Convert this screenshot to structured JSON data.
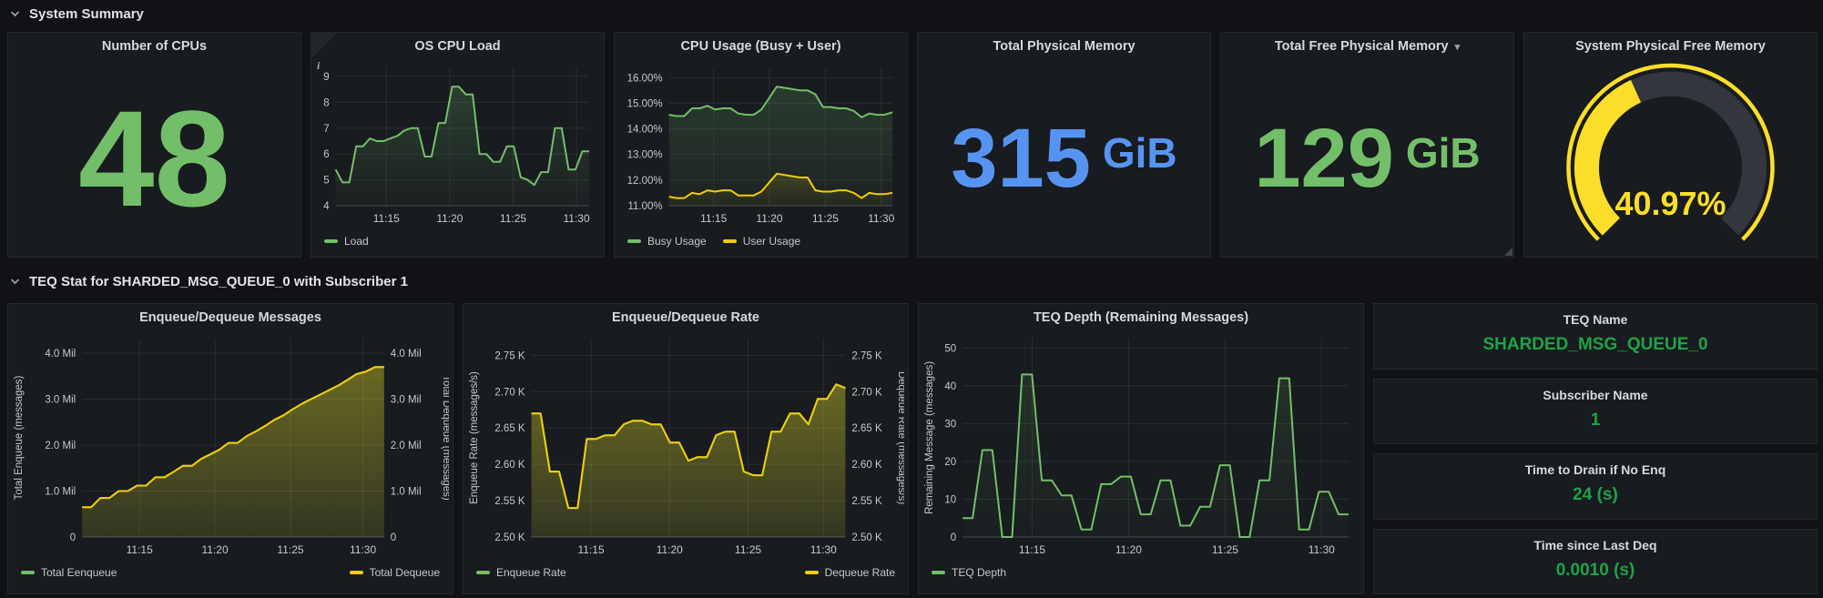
{
  "colors": {
    "green": "#73BF69",
    "yellow": "#F2CC0C",
    "blue": "#5794F2",
    "stat_green": "#1DA446",
    "gauge_yellow": "#FADE2A"
  },
  "sections": {
    "system": {
      "title": "System Summary"
    },
    "teq": {
      "title": "TEQ Stat for SHARDED_MSG_QUEUE_0 with Subscriber 1"
    }
  },
  "panels": {
    "num_cpus": {
      "title": "Number of CPUs",
      "value": "48"
    },
    "total_mem": {
      "title": "Total Physical Memory",
      "value": "315",
      "unit": "GiB"
    },
    "free_mem": {
      "title": "Total Free Physical Memory",
      "value": "129",
      "unit": "GiB"
    },
    "gauge": {
      "title": "System Physical Free Memory",
      "value": "40.97%",
      "percent": 40.97
    },
    "teq_name": {
      "title": "TEQ Name",
      "value": "SHARDED_MSG_QUEUE_0"
    },
    "subscriber": {
      "title": "Subscriber Name",
      "value": "1"
    },
    "drain": {
      "title": "Time to Drain if No Enq",
      "value": "24 (s)"
    },
    "last_deq": {
      "title": "Time since Last Deq",
      "value": "0.0010 (s)"
    }
  },
  "chart_data": [
    {
      "id": "os_cpu_load",
      "type": "line",
      "title": "OS CPU Load",
      "ylim": [
        4,
        9.35
      ],
      "yticks": [
        {
          "v": 4,
          "label": "4"
        },
        {
          "v": 5,
          "label": "5"
        },
        {
          "v": 6,
          "label": "6"
        },
        {
          "v": 7,
          "label": "7"
        },
        {
          "v": 8,
          "label": "8"
        },
        {
          "v": 9,
          "label": "9"
        }
      ],
      "xticks": [
        {
          "frac": 0.2,
          "label": "11:15"
        },
        {
          "frac": 0.45,
          "label": "11:20"
        },
        {
          "frac": 0.7,
          "label": "11:25"
        },
        {
          "frac": 0.95,
          "label": "11:30"
        }
      ],
      "right_ticks": false,
      "legend_split": false,
      "series": [
        {
          "name": "Load",
          "color": "#73BF69",
          "fill_top": 0.22,
          "fill_bottom": 0.03,
          "values": [
            5.4,
            4.9,
            4.9,
            6.3,
            6.3,
            6.6,
            6.5,
            6.5,
            6.6,
            6.7,
            6.9,
            7.0,
            7.0,
            5.9,
            5.9,
            7.2,
            7.2,
            8.6,
            8.6,
            8.3,
            8.3,
            6.0,
            6.0,
            5.7,
            5.7,
            6.3,
            6.3,
            5.1,
            5.0,
            4.8,
            5.3,
            5.3,
            7.0,
            7.0,
            5.4,
            5.4,
            6.1,
            6.1
          ]
        }
      ]
    },
    {
      "id": "cpu_usage",
      "type": "line",
      "title": "CPU Usage (Busy + User)",
      "ylim": [
        11,
        16.4
      ],
      "yticks": [
        {
          "v": 11,
          "label": "11.00%"
        },
        {
          "v": 12,
          "label": "12.00%"
        },
        {
          "v": 13,
          "label": "13.00%"
        },
        {
          "v": 14,
          "label": "14.00%"
        },
        {
          "v": 15,
          "label": "15.00%"
        },
        {
          "v": 16,
          "label": "16.00%"
        }
      ],
      "xticks": [
        {
          "frac": 0.2,
          "label": "11:15"
        },
        {
          "frac": 0.45,
          "label": "11:20"
        },
        {
          "frac": 0.7,
          "label": "11:25"
        },
        {
          "frac": 0.95,
          "label": "11:30"
        }
      ],
      "right_ticks": false,
      "legend_split": false,
      "series": [
        {
          "name": "Busy Usage",
          "color": "#73BF69",
          "fill_top": 0.2,
          "fill_bottom": 0.04,
          "values": [
            14.55,
            14.5,
            14.5,
            14.8,
            14.8,
            14.9,
            14.75,
            14.8,
            14.8,
            14.6,
            14.55,
            14.55,
            14.75,
            15.2,
            15.65,
            15.6,
            15.55,
            15.5,
            15.5,
            15.35,
            14.85,
            14.85,
            14.8,
            14.8,
            14.7,
            14.45,
            14.6,
            14.55,
            14.55,
            14.65
          ]
        },
        {
          "name": "User Usage",
          "color": "#F2CC0C",
          "fill_top": 0.16,
          "fill_bottom": 0.03,
          "values": [
            11.35,
            11.3,
            11.3,
            11.5,
            11.45,
            11.6,
            11.55,
            11.6,
            11.6,
            11.4,
            11.4,
            11.4,
            11.55,
            11.9,
            12.25,
            12.2,
            12.15,
            12.1,
            12.1,
            11.6,
            11.55,
            11.55,
            11.6,
            11.6,
            11.5,
            11.3,
            11.5,
            11.45,
            11.45,
            11.5
          ]
        }
      ]
    },
    {
      "id": "enq_deq_messages",
      "type": "area",
      "title": "Enqueue/Dequeue Messages",
      "ylim": [
        0,
        4.32
      ],
      "yticks": [
        {
          "v": 0,
          "label": "0"
        },
        {
          "v": 1,
          "label": "1.0 Mil"
        },
        {
          "v": 2,
          "label": "2.0 Mil"
        },
        {
          "v": 3,
          "label": "3.0 Mil"
        },
        {
          "v": 4,
          "label": "4.0 Mil"
        }
      ],
      "xticks": [
        {
          "frac": 0.19,
          "label": "11:15"
        },
        {
          "frac": 0.44,
          "label": "11:20"
        },
        {
          "frac": 0.69,
          "label": "11:25"
        },
        {
          "frac": 0.93,
          "label": "11:30"
        }
      ],
      "right_ticks": true,
      "legend_split": true,
      "axis_left": "Total Enqueue (messages)",
      "axis_right": "Total Dequeue (messages)",
      "series": [
        {
          "name": "Total Eenqueue",
          "color": "#73BF69",
          "fill_top": 0.18,
          "fill_bottom": 0.06,
          "values": [
            0.65,
            0.65,
            0.85,
            0.85,
            1.0,
            1.0,
            1.12,
            1.12,
            1.3,
            1.3,
            1.42,
            1.55,
            1.55,
            1.7,
            1.8,
            1.9,
            2.05,
            2.05,
            2.2,
            2.3,
            2.42,
            2.55,
            2.65,
            2.78,
            2.9,
            3.0,
            3.1,
            3.2,
            3.3,
            3.42,
            3.55,
            3.6,
            3.7,
            3.7
          ]
        },
        {
          "name": "Total Dequeue",
          "color": "#F2CC0C",
          "fill_top": 0.32,
          "fill_bottom": 0.1,
          "values": [
            0.65,
            0.65,
            0.85,
            0.85,
            1.0,
            1.0,
            1.12,
            1.12,
            1.3,
            1.3,
            1.42,
            1.55,
            1.55,
            1.7,
            1.8,
            1.9,
            2.05,
            2.05,
            2.2,
            2.3,
            2.42,
            2.55,
            2.65,
            2.78,
            2.9,
            3.0,
            3.1,
            3.2,
            3.3,
            3.42,
            3.55,
            3.6,
            3.7,
            3.7
          ]
        }
      ]
    },
    {
      "id": "enq_deq_rate",
      "type": "area",
      "title": "Enqueue/Dequeue Rate",
      "ylim": [
        2.5,
        2.773
      ],
      "yticks": [
        {
          "v": 2.5,
          "label": "2.50 K"
        },
        {
          "v": 2.55,
          "label": "2.55 K"
        },
        {
          "v": 2.6,
          "label": "2.60 K"
        },
        {
          "v": 2.65,
          "label": "2.65 K"
        },
        {
          "v": 2.7,
          "label": "2.70 K"
        },
        {
          "v": 2.75,
          "label": "2.75 K"
        }
      ],
      "xticks": [
        {
          "frac": 0.19,
          "label": "11:15"
        },
        {
          "frac": 0.44,
          "label": "11:20"
        },
        {
          "frac": 0.69,
          "label": "11:25"
        },
        {
          "frac": 0.93,
          "label": "11:30"
        }
      ],
      "right_ticks": true,
      "legend_split": true,
      "axis_left": "Enqueue Rate (messages/s)",
      "axis_right": "Dequeue Rate (messages/s)",
      "series": [
        {
          "name": "Enqueue Rate",
          "color": "#73BF69",
          "fill_top": 0.18,
          "fill_bottom": 0.06,
          "values": [
            2.67,
            2.67,
            2.59,
            2.59,
            2.54,
            2.54,
            2.635,
            2.635,
            2.64,
            2.64,
            2.655,
            2.66,
            2.66,
            2.655,
            2.655,
            2.63,
            2.63,
            2.605,
            2.61,
            2.61,
            2.64,
            2.645,
            2.645,
            2.59,
            2.585,
            2.585,
            2.645,
            2.645,
            2.67,
            2.67,
            2.655,
            2.69,
            2.69,
            2.71,
            2.705
          ]
        },
        {
          "name": "Dequeue Rate",
          "color": "#F2CC0C",
          "fill_top": 0.32,
          "fill_bottom": 0.1,
          "values": [
            2.67,
            2.67,
            2.59,
            2.59,
            2.54,
            2.54,
            2.635,
            2.635,
            2.64,
            2.64,
            2.655,
            2.66,
            2.66,
            2.655,
            2.655,
            2.63,
            2.63,
            2.605,
            2.61,
            2.61,
            2.64,
            2.645,
            2.645,
            2.59,
            2.585,
            2.585,
            2.645,
            2.645,
            2.67,
            2.67,
            2.655,
            2.69,
            2.69,
            2.71,
            2.705
          ]
        }
      ]
    },
    {
      "id": "teq_depth",
      "type": "line",
      "title": "TEQ Depth (Remaining Messages)",
      "ylim": [
        0,
        52.5
      ],
      "yticks": [
        {
          "v": 0,
          "label": "0"
        },
        {
          "v": 10,
          "label": "10"
        },
        {
          "v": 20,
          "label": "20"
        },
        {
          "v": 30,
          "label": "30"
        },
        {
          "v": 40,
          "label": "40"
        },
        {
          "v": 50,
          "label": "50"
        }
      ],
      "xticks": [
        {
          "frac": 0.18,
          "label": "11:15"
        },
        {
          "frac": 0.43,
          "label": "11:20"
        },
        {
          "frac": 0.68,
          "label": "11:25"
        },
        {
          "frac": 0.93,
          "label": "11:30"
        }
      ],
      "right_ticks": false,
      "legend_split": false,
      "axis_left": "Remaining Message (messages)",
      "series": [
        {
          "name": "TEQ Depth",
          "color": "#73BF69",
          "fill_top": 0.14,
          "fill_bottom": 0.02,
          "values": [
            5,
            5,
            23,
            23,
            0,
            0,
            43,
            43,
            15,
            15,
            11,
            11,
            2,
            2,
            14,
            14,
            16,
            16,
            6,
            6,
            15,
            15,
            3,
            3,
            8,
            8,
            19,
            19,
            0,
            0,
            15,
            15,
            42,
            42,
            2,
            2,
            12,
            12,
            6,
            6
          ]
        }
      ]
    }
  ]
}
